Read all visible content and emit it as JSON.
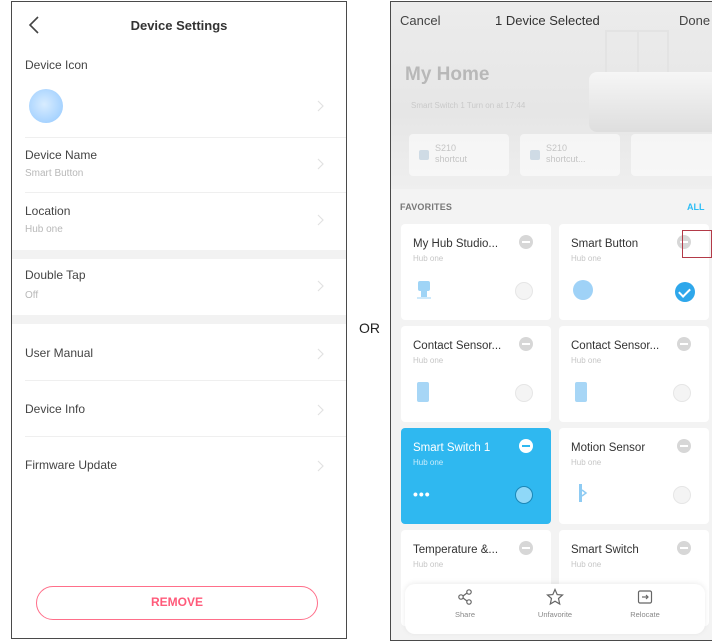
{
  "left": {
    "title": "Device Settings",
    "rows": {
      "device_icon": "Device Icon",
      "device_name": "Device Name",
      "device_name_value": "Smart Button",
      "location": "Location",
      "location_value": "Hub one",
      "double_tap": "Double Tap",
      "double_tap_value": "Off",
      "user_manual": "User Manual",
      "device_info": "Device Info",
      "firmware_update": "Firmware Update"
    },
    "remove_label": "REMOVE"
  },
  "or_label": "OR",
  "right": {
    "cancel": "Cancel",
    "selected": "1 Device Selected",
    "done": "Done",
    "home": "My Home",
    "home_sub": "Smart Switch 1 Turn on at 17:44",
    "shortcuts": [
      {
        "line1": "S210",
        "line2": "shortcut"
      },
      {
        "line1": "S210",
        "line2": "shortcut..."
      }
    ],
    "favorites_title": "FAVORITES",
    "all": "ALL",
    "cards": [
      {
        "name": "My Hub Studio...",
        "sub": "Hub one"
      },
      {
        "name": "Smart Button",
        "sub": "Hub one"
      },
      {
        "name": "Contact Sensor...",
        "sub": "Hub one"
      },
      {
        "name": "Contact Sensor...",
        "sub": "Hub one"
      },
      {
        "name": "Smart Switch 1",
        "sub": "Hub one",
        "dots": "•••"
      },
      {
        "name": "Motion Sensor",
        "sub": "Hub one"
      },
      {
        "name": "Temperature &...",
        "sub": "Hub one"
      },
      {
        "name": "Smart Switch",
        "sub": "Hub one"
      }
    ],
    "bottom_bar": {
      "share": "Share",
      "unfavorite": "Unfavorite",
      "relocate": "Relocate"
    },
    "accent_color": "#2fb8f0",
    "remove_color": "#ff5a7a"
  }
}
